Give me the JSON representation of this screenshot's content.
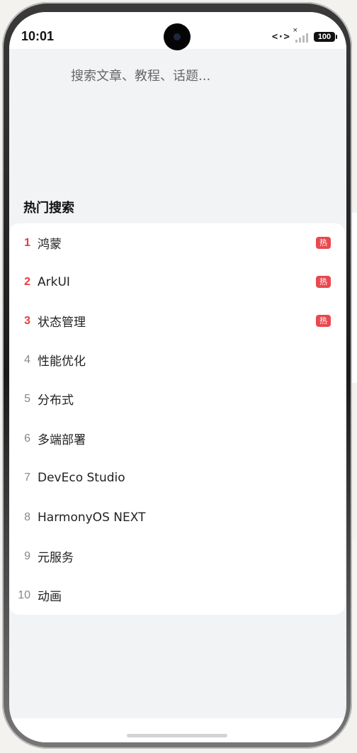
{
  "status_bar": {
    "time": "10:01",
    "battery": "100"
  },
  "search": {
    "placeholder": "搜索文章、教程、话题..."
  },
  "hot_search": {
    "title": "热门搜索",
    "badge": "热",
    "items": [
      {
        "rank": "1",
        "term": "鸿蒙",
        "hot": true
      },
      {
        "rank": "2",
        "term": "ArkUI",
        "hot": true
      },
      {
        "rank": "3",
        "term": "状态管理",
        "hot": true
      },
      {
        "rank": "4",
        "term": "性能优化",
        "hot": false
      },
      {
        "rank": "5",
        "term": "分布式",
        "hot": false
      },
      {
        "rank": "6",
        "term": "多端部署",
        "hot": false
      },
      {
        "rank": "7",
        "term": "DevEco Studio",
        "hot": false
      },
      {
        "rank": "8",
        "term": "HarmonyOS NEXT",
        "hot": false
      },
      {
        "rank": "9",
        "term": "元服务",
        "hot": false
      },
      {
        "rank": "10",
        "term": "动画",
        "hot": false
      }
    ]
  },
  "colors": {
    "hot_rank": "#e83b3b",
    "hot_badge": "#e8484e",
    "screen_bg": "#f2f3f5"
  }
}
